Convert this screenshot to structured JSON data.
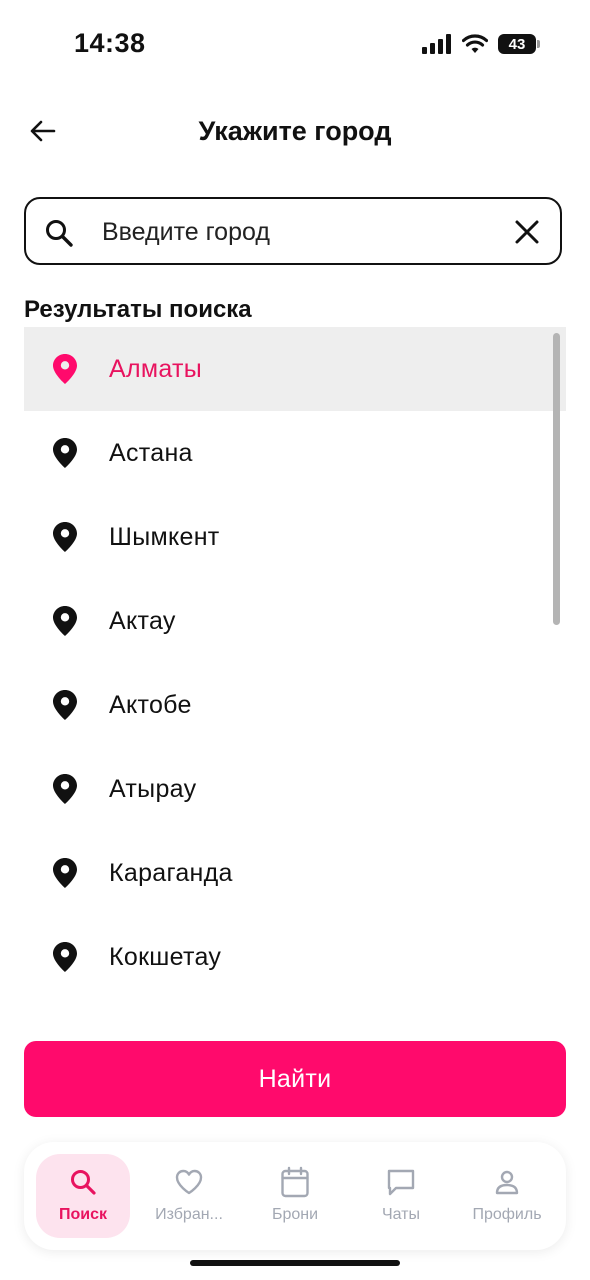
{
  "status_bar": {
    "time": "14:38",
    "battery": "43"
  },
  "header": {
    "title": "Укажите город"
  },
  "search": {
    "placeholder": "Введите город",
    "value": ""
  },
  "results": {
    "heading": "Результаты поиска",
    "items": [
      {
        "label": "Алматы",
        "selected": true
      },
      {
        "label": "Астана"
      },
      {
        "label": "Шымкент"
      },
      {
        "label": "Актау"
      },
      {
        "label": "Актобе"
      },
      {
        "label": "Атырау"
      },
      {
        "label": "Караганда"
      },
      {
        "label": "Кокшетау"
      }
    ]
  },
  "actions": {
    "find_label": "Найти"
  },
  "tabbar": {
    "tabs": [
      {
        "label": "Поиск",
        "icon": "search-icon",
        "active": true
      },
      {
        "label": "Избран...",
        "icon": "heart-icon"
      },
      {
        "label": "Брони",
        "icon": "calendar-icon"
      },
      {
        "label": "Чаты",
        "icon": "chat-icon"
      },
      {
        "label": "Профиль",
        "icon": "user-icon"
      }
    ]
  },
  "colors": {
    "accent": "#ff0a6c",
    "accent_text": "#e8135f",
    "selected_row": "#eeeeee",
    "tab_inactive": "#a3a8b3"
  }
}
